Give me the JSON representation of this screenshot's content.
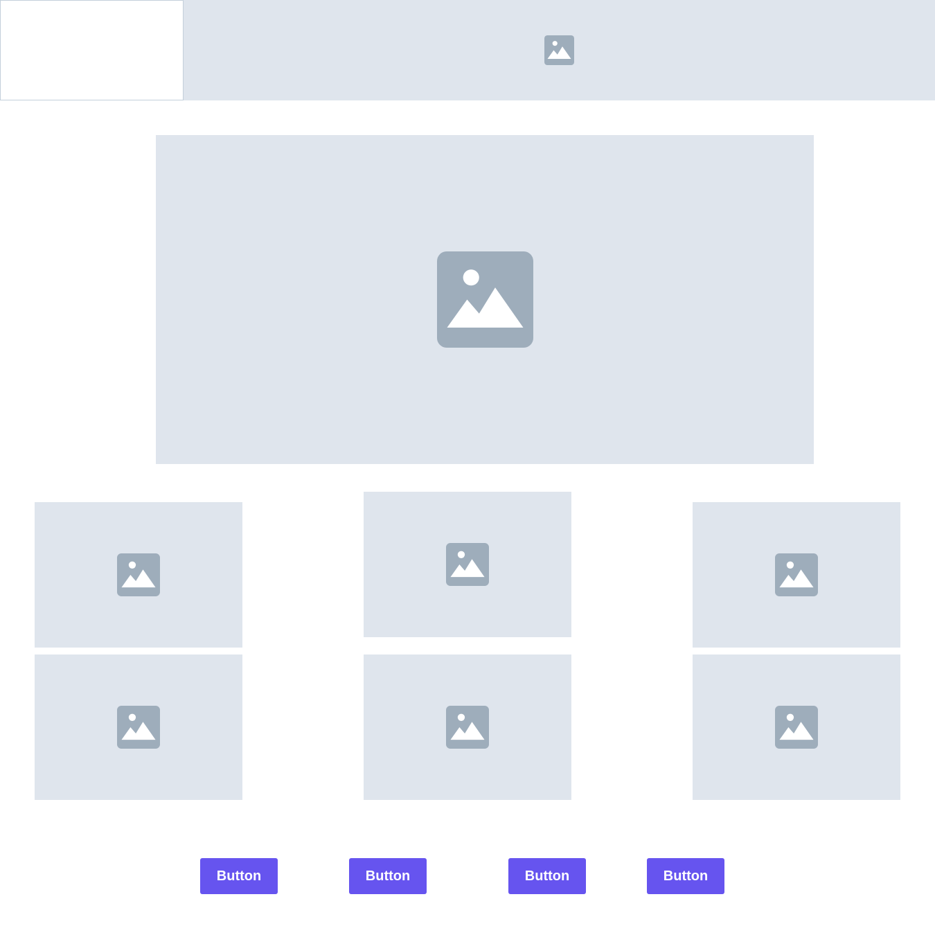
{
  "header": {
    "logo_box": {},
    "banner_image": {
      "icon": "image-icon"
    }
  },
  "hero": {
    "image": {
      "icon": "image-icon"
    }
  },
  "gallery": {
    "tiles": [
      {
        "icon": "image-icon"
      },
      {
        "icon": "image-icon"
      },
      {
        "icon": "image-icon"
      },
      {
        "icon": "image-icon"
      },
      {
        "icon": "image-icon"
      },
      {
        "icon": "image-icon"
      }
    ]
  },
  "actions": {
    "buttons": [
      {
        "label": "Button"
      },
      {
        "label": "Button"
      },
      {
        "label": "Button"
      },
      {
        "label": "Button"
      }
    ]
  },
  "colors": {
    "placeholder_bg": "#dfe5ed",
    "icon": "#9eadbb",
    "button_bg": "#6654ef",
    "button_text": "#ffffff",
    "border": "#c3cfdb"
  }
}
